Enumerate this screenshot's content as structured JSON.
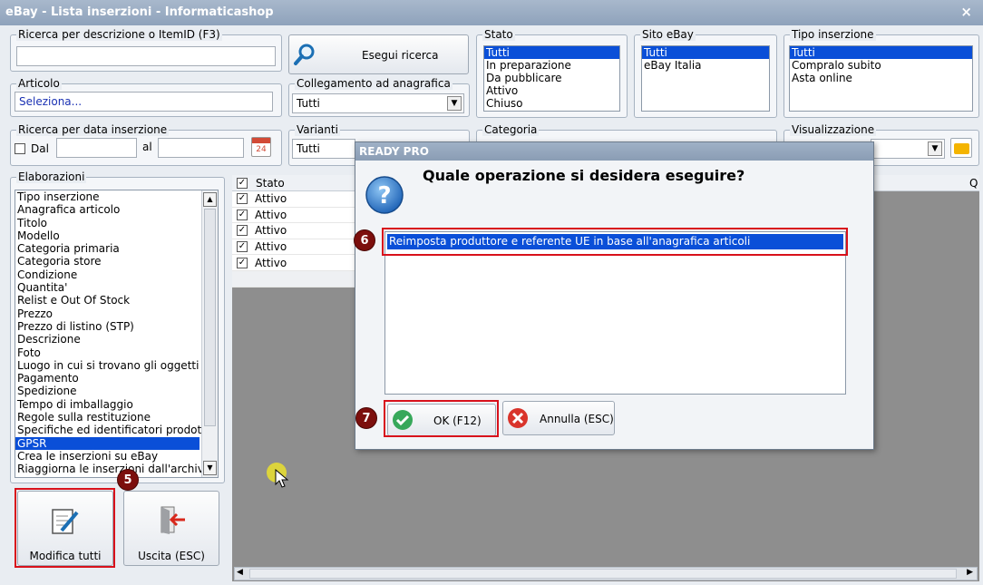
{
  "window": {
    "title": "eBay - Lista inserzioni - Informaticashop",
    "close": "×"
  },
  "search": {
    "label": "Ricerca per descrizione o ItemID (F3)",
    "value": "",
    "button": "Esegui ricerca"
  },
  "articolo": {
    "label": "Articolo",
    "value": "Seleziona..."
  },
  "collegamento": {
    "label": "Collegamento ad anagrafica",
    "value": "Tutti"
  },
  "stato": {
    "label": "Stato",
    "items": [
      "Tutti",
      "In preparazione",
      "Da pubblicare",
      "Attivo",
      "Chiuso"
    ]
  },
  "sito": {
    "label": "Sito eBay",
    "items": [
      "Tutti",
      "eBay Italia"
    ]
  },
  "tipo": {
    "label": "Tipo inserzione",
    "items": [
      "Tutti",
      "Compralo subito",
      "Asta online"
    ]
  },
  "data_ins": {
    "label": "Ricerca per data inserzione",
    "dal": "Dal",
    "al": "al",
    "cal_day": "24"
  },
  "varianti": {
    "label": "Varianti",
    "value": "Tutti"
  },
  "categoria": {
    "label": "Categoria"
  },
  "visualizzazione": {
    "label": "Visualizzazione"
  },
  "elaborazioni": {
    "label": "Elaborazioni",
    "items": [
      "Tipo inserzione",
      "Anagrafica articolo",
      "Titolo",
      "Modello",
      "Categoria primaria",
      "Categoria store",
      "Condizione",
      "Quantita'",
      "Relist e Out Of Stock",
      "Prezzo",
      "Prezzo di listino (STP)",
      "Descrizione",
      "Foto",
      "Luogo in cui si trovano gli oggetti",
      "Pagamento",
      "Spedizione",
      "Tempo di imballaggio",
      "Regole sulla restituzione",
      "Specifiche ed identificatori prodotto",
      "GPSR",
      "Crea le inserzioni su eBay",
      "Riaggiorna le inserzioni dall'archivio"
    ],
    "selected": "GPSR"
  },
  "buttons": {
    "modifica": "Modifica tutti",
    "uscita": "Uscita (ESC)"
  },
  "grid": {
    "col_stato": "Stato",
    "col_q": "Q",
    "rows": [
      "Attivo",
      "Attivo",
      "Attivo",
      "Attivo",
      "Attivo"
    ]
  },
  "dialog": {
    "title": "READY PRO",
    "question": "Quale operazione si desidera eseguire?",
    "option": "Reimposta produttore e referente UE in base all'anagrafica articoli",
    "ok": "OK (F12)",
    "cancel": "Annulla (ESC)"
  },
  "badges": {
    "b5": "5",
    "b6": "6",
    "b7": "7"
  },
  "colors": {
    "selection": "#0a4fd8",
    "highlight_box": "#d8111b",
    "badge": "#7c0f0d"
  }
}
